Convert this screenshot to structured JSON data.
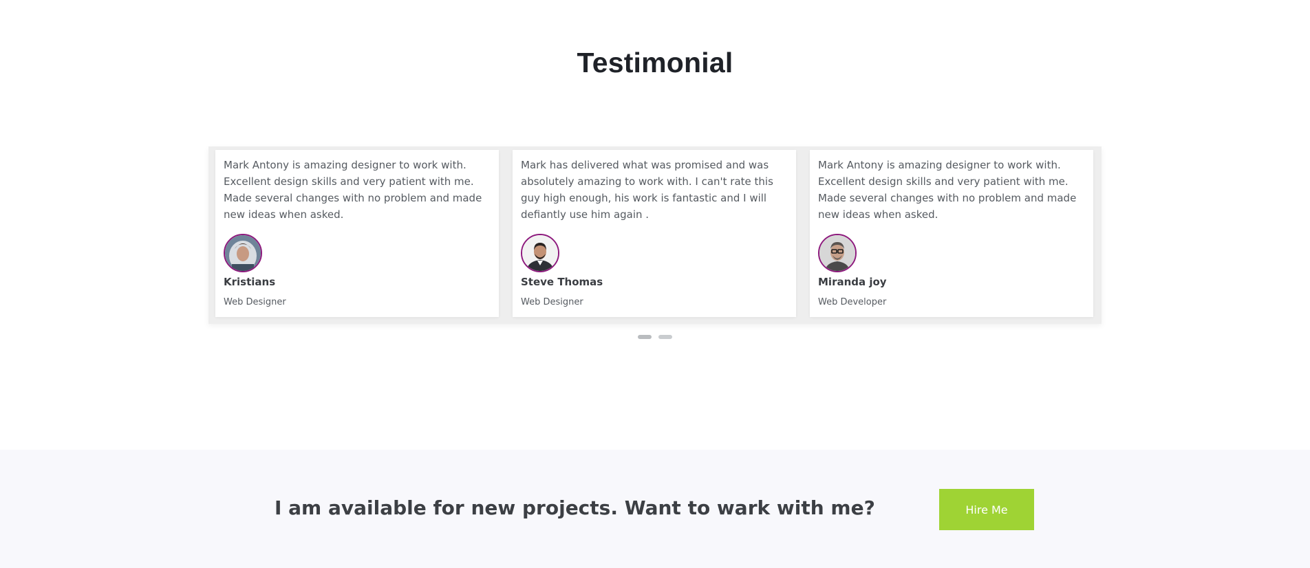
{
  "testimonial": {
    "title": "Testimonial",
    "cards": [
      {
        "quote": "Mark Antony is amazing designer to work with. Excellent design skills and very patient with me. Made several changes with no problem and made new ideas when asked.",
        "name": "Kristians",
        "role": "Web Designer"
      },
      {
        "quote": "Mark has delivered what was promised and was absolutely amazing to work with. I can't rate this guy high enough, his work is fantastic and I will defiantly use him again .",
        "name": "Steve Thomas",
        "role": "Web Designer"
      },
      {
        "quote": "Mark Antony is amazing designer to work with. Excellent design skills and very patient with me. Made several changes with no problem and made new ideas when asked.",
        "name": "Miranda joy",
        "role": "Web Developer"
      }
    ],
    "pagination": {
      "pages": 2,
      "active_page": 1
    }
  },
  "cta": {
    "text": "I am available for new projects. Want to wark with me?",
    "button_label": "Hire Me"
  },
  "colors": {
    "accent": "#9fd334",
    "avatar_ring": "#8d1a7d",
    "cta_background": "#f8f8fc"
  }
}
